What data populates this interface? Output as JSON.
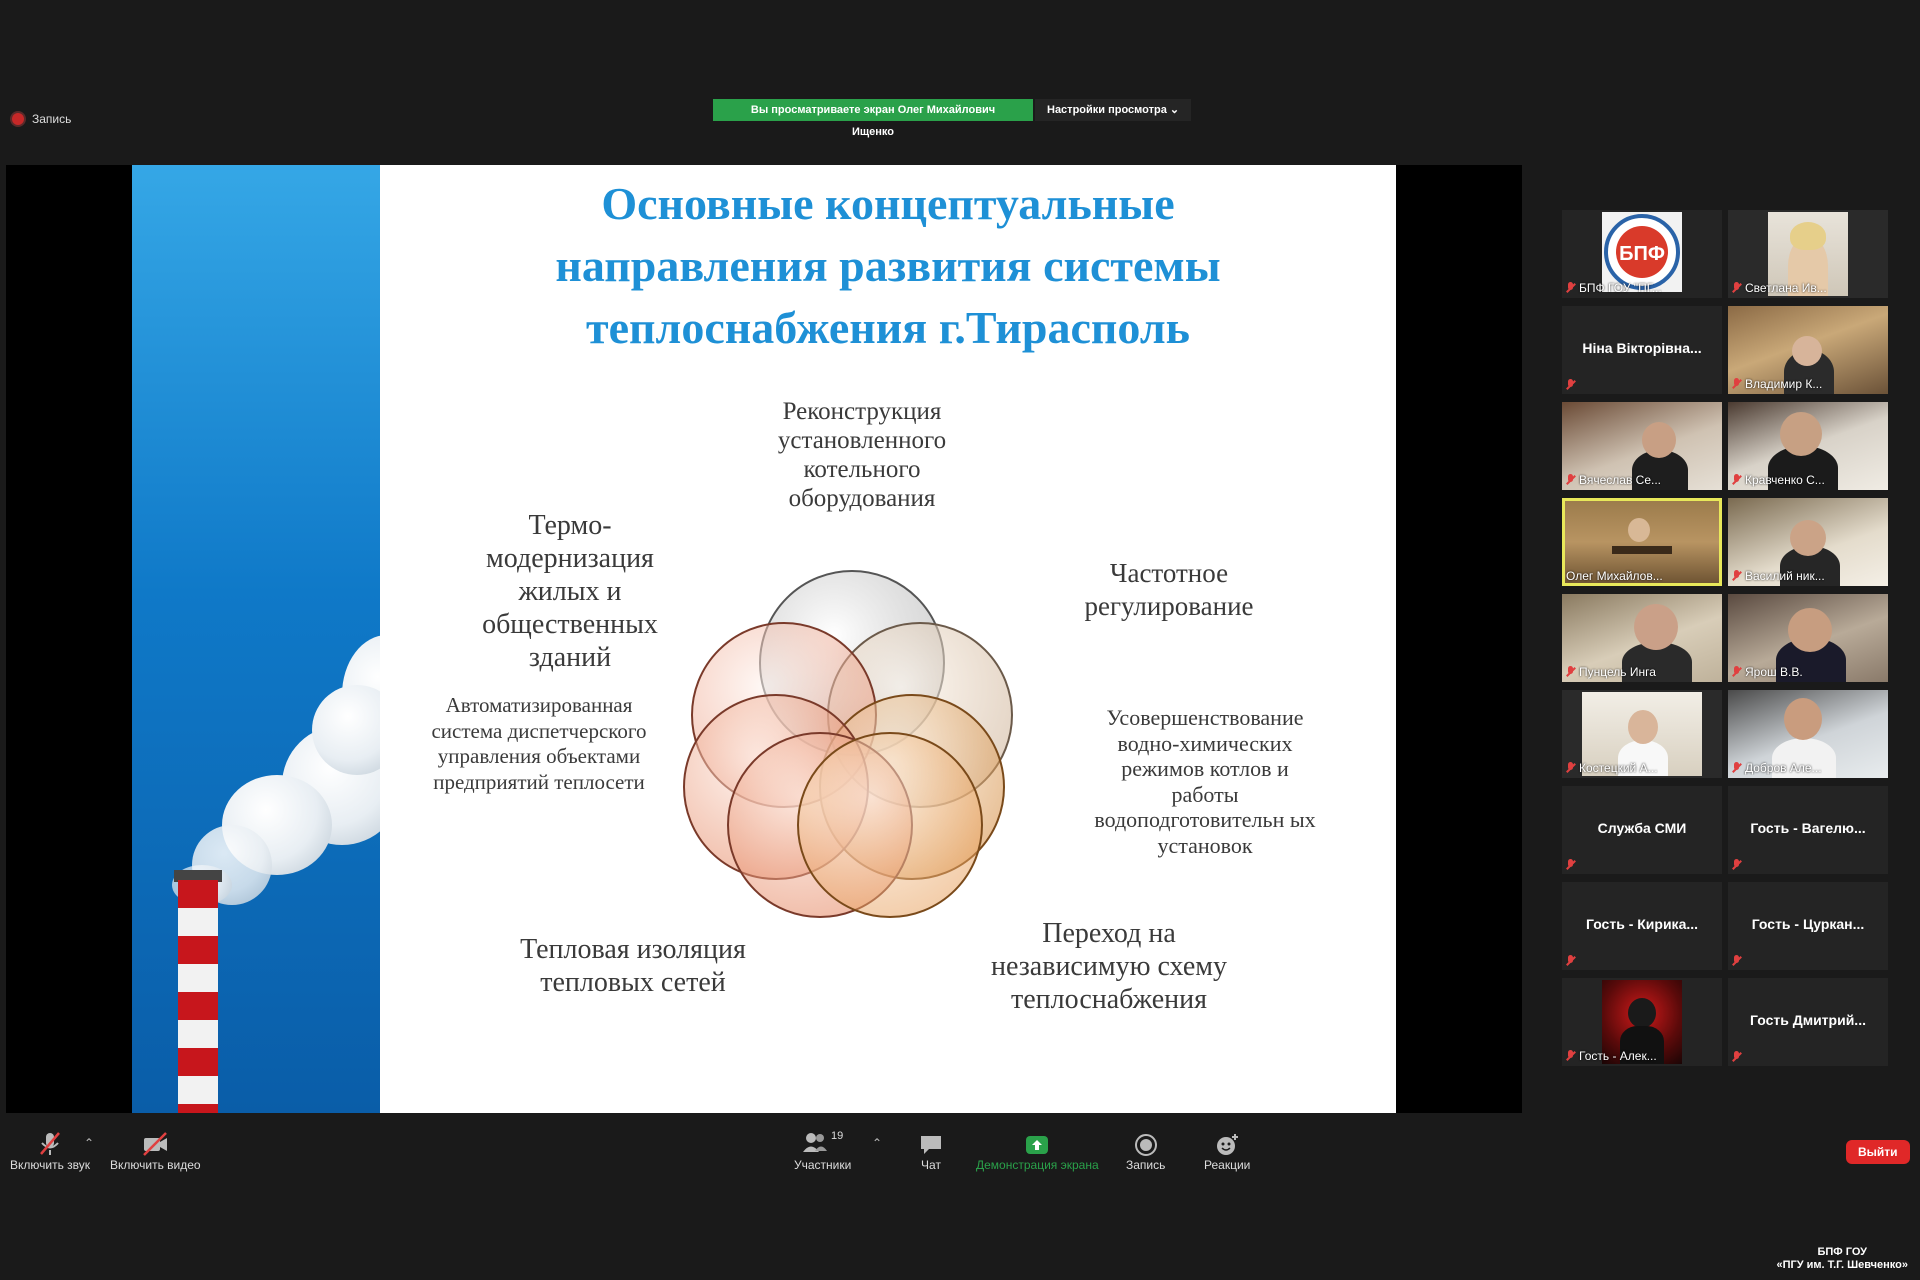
{
  "recording": {
    "label": "Запись"
  },
  "share_banner": {
    "viewing": "Вы просматриваете экран Олег Михайлович Ищенко",
    "view_options": "Настройки просмотра ⌄"
  },
  "slide": {
    "title_lines": [
      "Основные концептуальные",
      "направления развития системы",
      "теплоснабжения г.Тирасполь"
    ],
    "labels": {
      "reconstruction": "Реконструкция установленного котельного оборудования",
      "thermo": "Термо- модернизация жилых и общественных зданий",
      "frequency": "Частотное регулирование",
      "automated": "Автоматизированная система диспетчерского управления объектами предприятий теплосети",
      "improvement": "Усовершенствование водно-химических режимов котлов и работы водоподготовительн ых установок",
      "insulation": "Тепловая изоляция тепловых сетей",
      "transition": "Переход на независимую схему теплоснабжения"
    }
  },
  "participants": [
    {
      "name": "БПФ ГОУ \"ПГ...",
      "type": "logo"
    },
    {
      "name": "Светлана Ив...",
      "type": "video"
    },
    {
      "name": "Ніна Вікторівна...",
      "type": "name"
    },
    {
      "name": "Владимир К...",
      "type": "video"
    },
    {
      "name": "Вячеслав Се...",
      "type": "video"
    },
    {
      "name": "Кравченко С...",
      "type": "video"
    },
    {
      "name": "Олег Михайлов...",
      "type": "video",
      "active": true
    },
    {
      "name": "Василий ник...",
      "type": "video"
    },
    {
      "name": "Пунцель Инга",
      "type": "video"
    },
    {
      "name": "Ярош В.В.",
      "type": "video"
    },
    {
      "name": "Костецкий А...",
      "type": "video"
    },
    {
      "name": "Добров Але...",
      "type": "video"
    },
    {
      "name": "Служба СМИ",
      "type": "name"
    },
    {
      "name": "Гость - Вагелю...",
      "type": "name"
    },
    {
      "name": "Гость - Кирика...",
      "type": "name"
    },
    {
      "name": "Гость - Цуркан...",
      "type": "name"
    },
    {
      "name": "Гость - Алек...",
      "type": "image"
    },
    {
      "name": "Гость Дмитрий...",
      "type": "name"
    }
  ],
  "logo_text": "БПФ",
  "toolbar": {
    "unmute": "Включить звук",
    "start_video": "Включить видео",
    "participants": "Участники",
    "participants_count": "19",
    "chat": "Чат",
    "share_screen": "Демонстрация экрана",
    "record": "Запись",
    "reactions": "Реакции",
    "leave": "Выйти"
  },
  "watermark": {
    "line1": "БПФ ГОУ",
    "line2": "«ПГУ им. Т.Г. Шевченко»"
  },
  "colors": {
    "share_green": "#2aa14a",
    "leave_red": "#e02828",
    "title_blue": "#1e90d6",
    "active_border": "#e8e85a"
  }
}
